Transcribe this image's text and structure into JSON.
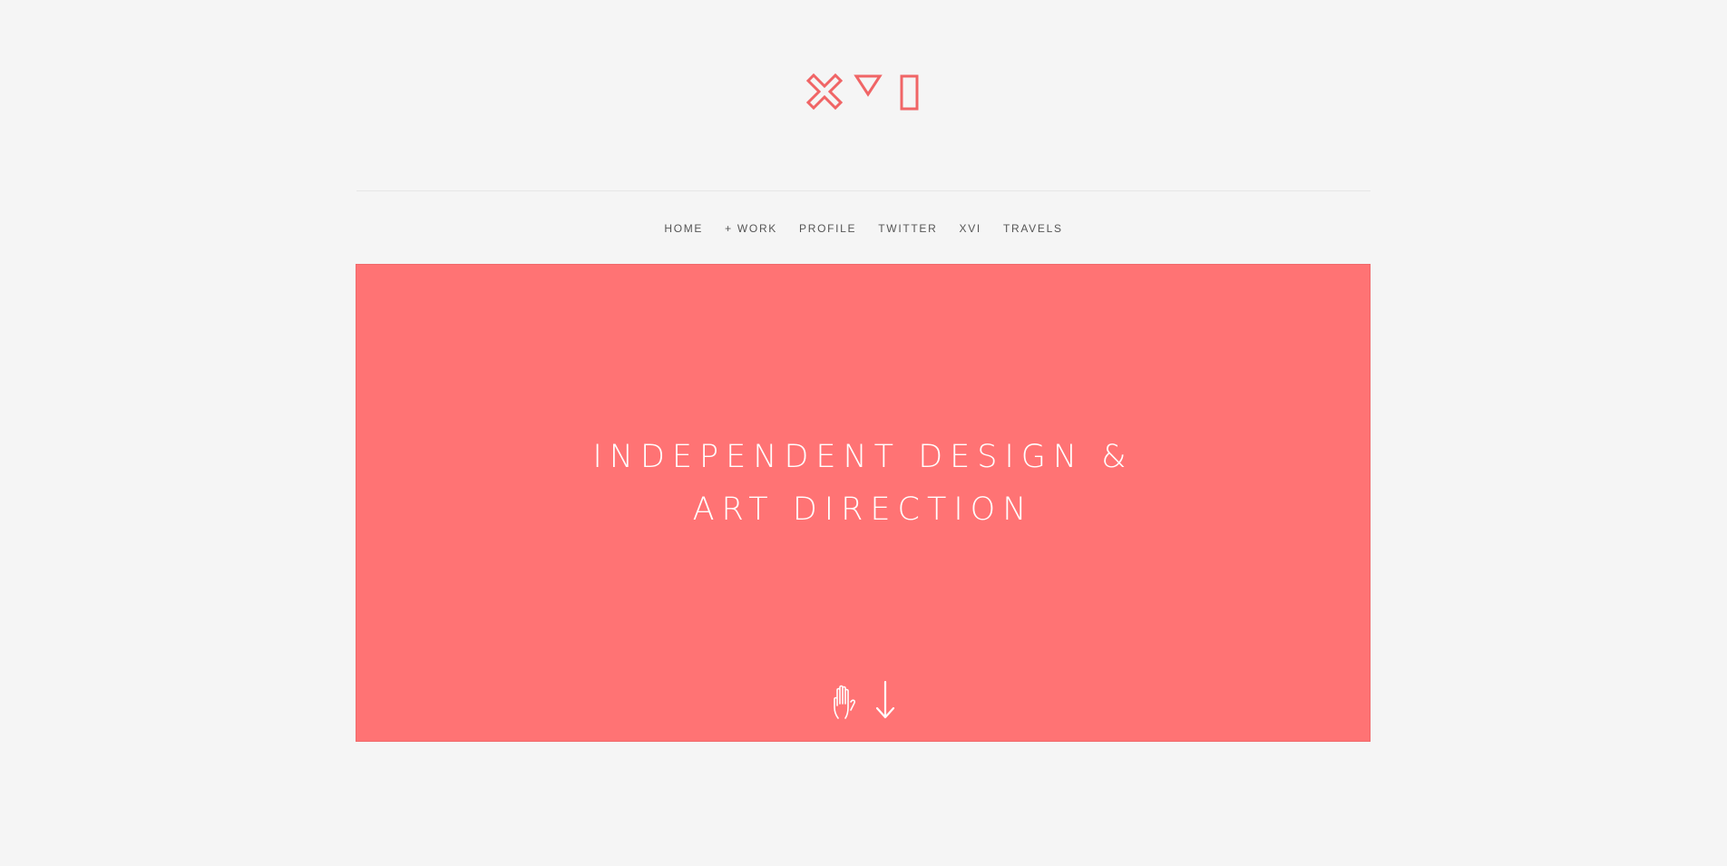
{
  "brand": {
    "logo_icons": [
      "x-cross-icon",
      "triangle-down-icon",
      "rectangle-icon"
    ],
    "accent_color": "#ff7374"
  },
  "nav": {
    "items": [
      {
        "label": "HOME"
      },
      {
        "label": "+ WORK"
      },
      {
        "label": "PROFILE"
      },
      {
        "label": "TWITTER"
      },
      {
        "label": "XVI"
      },
      {
        "label": "TRAVELS"
      }
    ]
  },
  "hero": {
    "title_line1": "INDEPENDENT DESIGN &",
    "title_line2": "ART DIRECTION",
    "background_color": "#ff7374",
    "scroll_icons": [
      "hand-icon",
      "arrow-down-icon"
    ]
  }
}
